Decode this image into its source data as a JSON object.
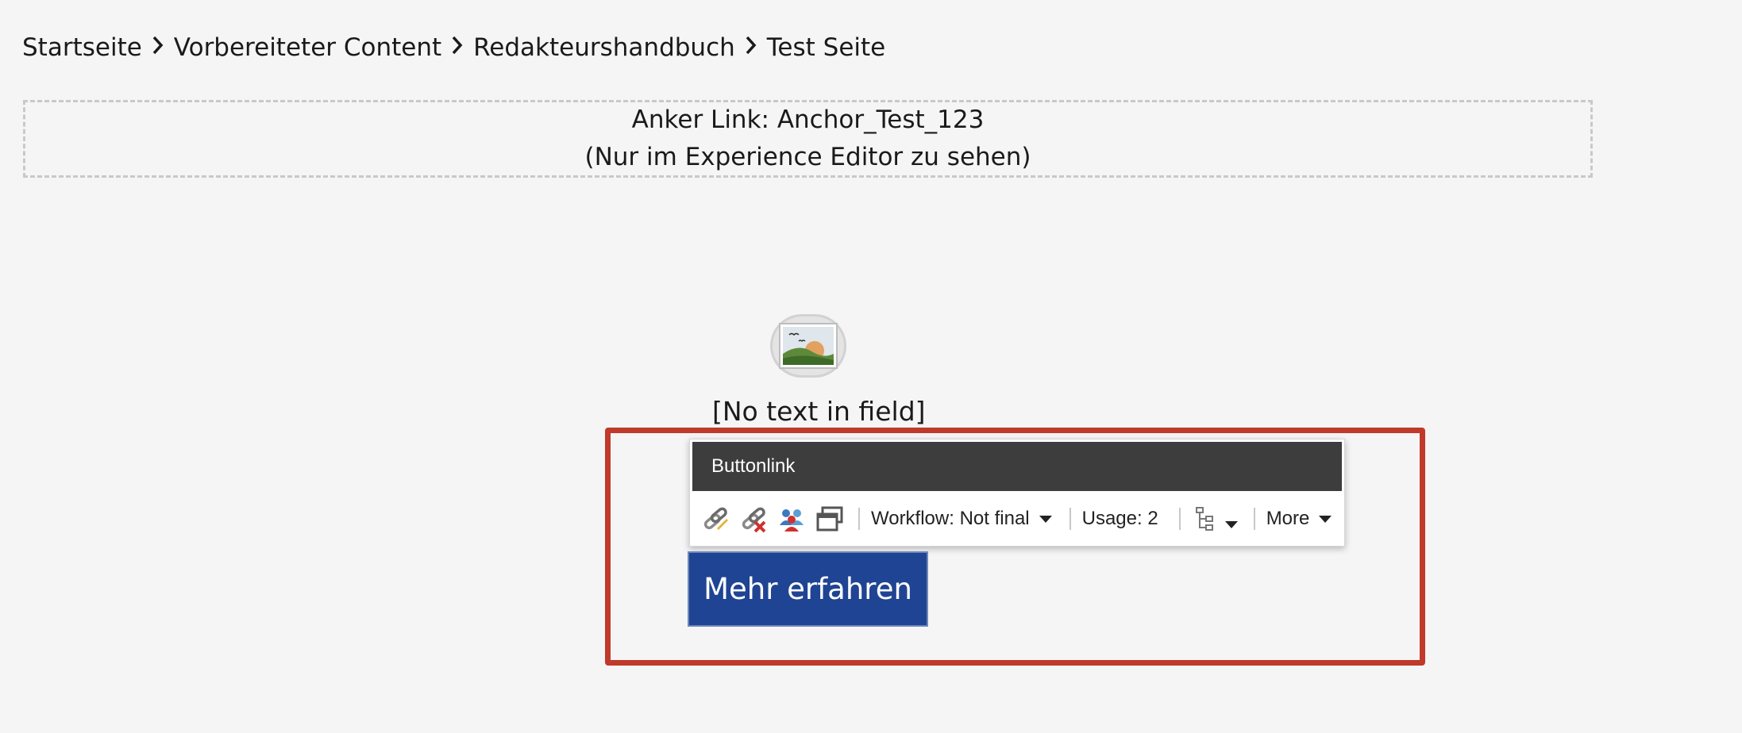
{
  "breadcrumb": {
    "items": [
      "Startseite",
      "Vorbereiteter Content",
      "Redakteurshandbuch",
      "Test Seite"
    ]
  },
  "anchor_box": {
    "line1": "Anker Link: Anchor_Test_123",
    "line2": "(Nur im Experience Editor zu sehen)"
  },
  "image_field": {
    "icon": "image-placeholder-icon",
    "empty_text": "[No text in field]"
  },
  "toolbar": {
    "title": "Buttonlink",
    "icons": [
      "edit-link-icon",
      "remove-link-icon",
      "personalize-icon",
      "window-icon",
      "structure-icon"
    ],
    "workflow_label": "Workflow: Not final",
    "usage_label": "Usage: 2",
    "more_label": "More"
  },
  "cta": {
    "label": "Mehr erfahren",
    "color": "#1f4493"
  },
  "colors": {
    "highlight": "#c0392b",
    "toolbar_header": "#3d3d3d",
    "background": "#f5f5f5"
  }
}
